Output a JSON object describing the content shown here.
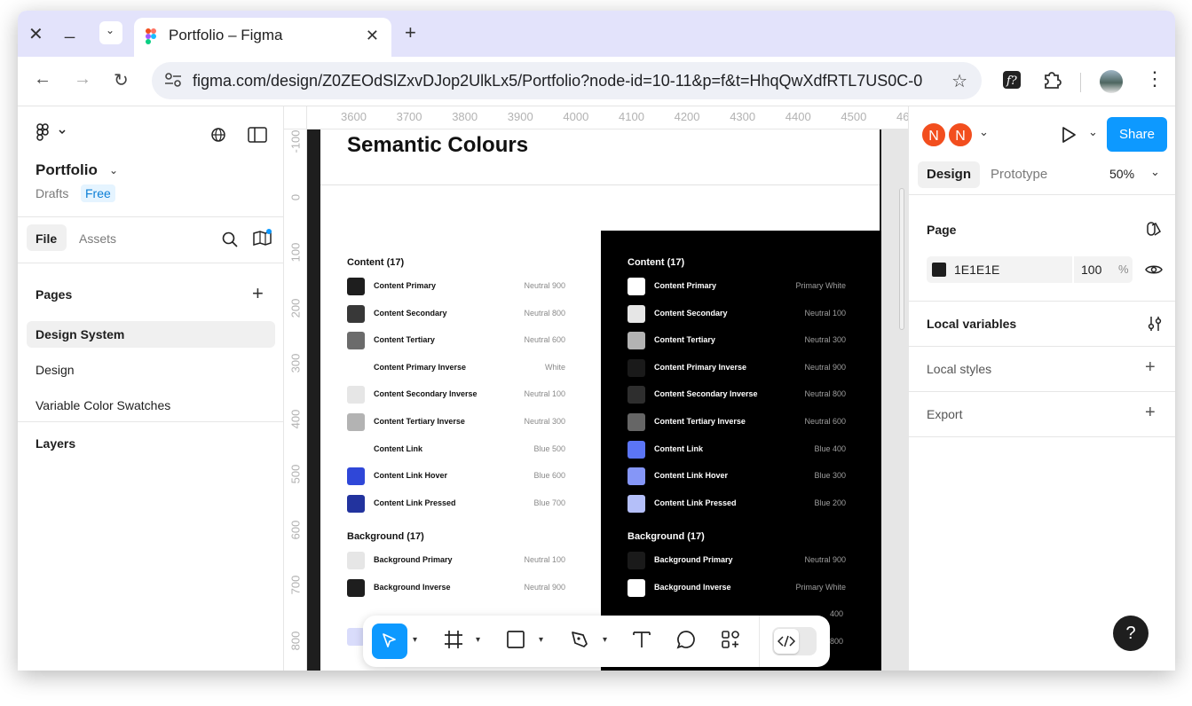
{
  "browser": {
    "tab_title": "Portfolio – Figma",
    "url": "figma.com/design/Z0ZEOdSlZxvDJop2UlkLx5/Portfolio?node-id=10-11&p=f&t=HhqQwXdfRTL7US0C-0"
  },
  "left_panel": {
    "file_name": "Portfolio",
    "location": "Drafts",
    "plan_badge": "Free",
    "tabs": {
      "file": "File",
      "assets": "Assets"
    },
    "pages_header": "Pages",
    "pages": [
      "Design System",
      "Design",
      "Variable Color Swatches"
    ],
    "layers_header": "Layers"
  },
  "canvas": {
    "ruler_top": [
      "3600",
      "3700",
      "3800",
      "3900",
      "4000",
      "4100",
      "4200",
      "4300",
      "4400",
      "4500",
      "46"
    ],
    "ruler_left": [
      "-100",
      "0",
      "100",
      "200",
      "300",
      "400",
      "500",
      "600",
      "700",
      "800"
    ],
    "frame_title": "Semantic Colours",
    "light": {
      "content_header": "Content (17)",
      "content": [
        {
          "name": "Content Primary",
          "value": "Neutral 900",
          "color": "#1e1e1e"
        },
        {
          "name": "Content Secondary",
          "value": "Neutral 800",
          "color": "#383838"
        },
        {
          "name": "Content Tertiary",
          "value": "Neutral 600",
          "color": "#6b6b6b"
        },
        {
          "name": "Content Primary Inverse",
          "value": "White",
          "color": "#ffffff"
        },
        {
          "name": "Content Secondary Inverse",
          "value": "Neutral 100",
          "color": "#e6e6e6"
        },
        {
          "name": "Content Tertiary Inverse",
          "value": "Neutral 300",
          "color": "#b3b3b3"
        },
        {
          "name": "Content Link",
          "value": "Blue 500",
          "color": "#ffffff"
        },
        {
          "name": "Content Link Hover",
          "value": "Blue 600",
          "color": "#2f47d8"
        },
        {
          "name": "Content Link Pressed",
          "value": "Blue 700",
          "color": "#22339e"
        }
      ],
      "background_header": "Background (17)",
      "background": [
        {
          "name": "Background Primary",
          "value": "Neutral 100",
          "color": "#e6e6e6"
        },
        {
          "name": "Background Inverse",
          "value": "Neutral 900",
          "color": "#1e1e1e"
        }
      ]
    },
    "dark": {
      "content_header": "Content (17)",
      "content": [
        {
          "name": "Content Primary",
          "value": "Primary White",
          "color": "#ffffff"
        },
        {
          "name": "Content Secondary",
          "value": "Neutral 100",
          "color": "#e6e6e6"
        },
        {
          "name": "Content Tertiary",
          "value": "Neutral 300",
          "color": "#b3b3b3"
        },
        {
          "name": "Content Primary Inverse",
          "value": "Neutral 900",
          "color": "#1a1a1a"
        },
        {
          "name": "Content Secondary Inverse",
          "value": "Neutral 800",
          "color": "#2e2e2e"
        },
        {
          "name": "Content Tertiary Inverse",
          "value": "Neutral 600",
          "color": "#666666"
        },
        {
          "name": "Content Link",
          "value": "Blue 400",
          "color": "#5b75f5"
        },
        {
          "name": "Content Link Hover",
          "value": "Blue 300",
          "color": "#8596f7"
        },
        {
          "name": "Content Link Pressed",
          "value": "Blue 200",
          "color": "#b4bff9"
        }
      ],
      "background_header": "Background (17)",
      "background": [
        {
          "name": "Background Primary",
          "value": "Neutral 900",
          "color": "#1a1a1a"
        },
        {
          "name": "Background Inverse",
          "value": "Primary White",
          "color": "#ffffff"
        }
      ],
      "partial_values": [
        "400",
        "800"
      ]
    }
  },
  "right_panel": {
    "avatars": [
      "N",
      "N"
    ],
    "share": "Share",
    "tabs": {
      "design": "Design",
      "prototype": "Prototype"
    },
    "zoom": "50%",
    "page_label": "Page",
    "page_color": "1E1E1E",
    "page_opacity": "100",
    "percent": "%",
    "local_variables": "Local variables",
    "local_styles": "Local styles",
    "export": "Export",
    "help": "?"
  }
}
